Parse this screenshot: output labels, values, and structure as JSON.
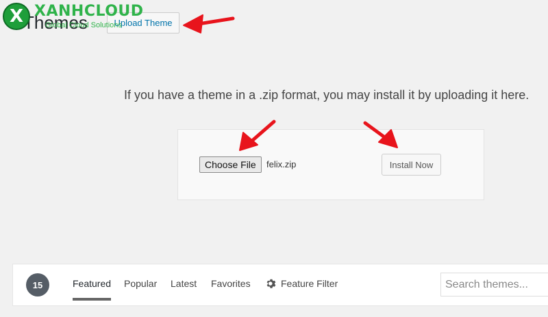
{
  "header": {
    "title": "Themes",
    "upload_label": "Upload Theme"
  },
  "logo": {
    "name": "XANHCLOUD",
    "tagline": "Global Cloud Solutions",
    "mark": "X"
  },
  "upload": {
    "description": "If you have a theme in a .zip format, you may install it by uploading it here.",
    "choose_file_label": "Choose File",
    "file_name": "felix.zip",
    "install_label": "Install Now"
  },
  "filter": {
    "count": "15",
    "tabs": [
      {
        "label": "Featured",
        "active": true
      },
      {
        "label": "Popular"
      },
      {
        "label": "Latest"
      },
      {
        "label": "Favorites"
      }
    ],
    "feature_filter_label": "Feature Filter",
    "search_placeholder": "Search themes..."
  },
  "colors": {
    "annotation_arrow": "#e8141c",
    "logo_green": "#2fb34a",
    "link_blue": "#0073aa"
  }
}
